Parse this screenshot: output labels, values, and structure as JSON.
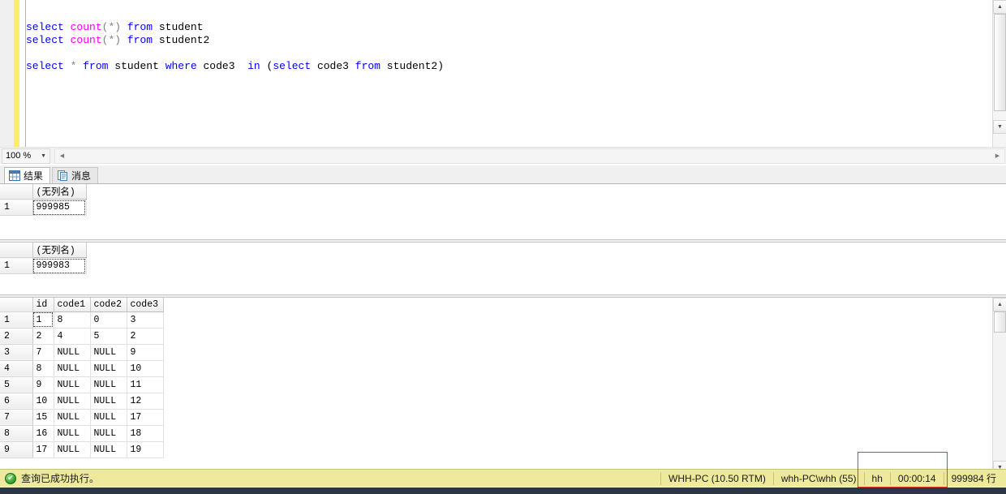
{
  "editor": {
    "zoom_level": "100 %",
    "change_bar_color": "#fbeb6e",
    "lines": [
      [
        {
          "t": "select",
          "c": "kw"
        },
        {
          "t": " ",
          "c": "plain"
        },
        {
          "t": "count",
          "c": "fn"
        },
        {
          "t": "(*)",
          "c": "op"
        },
        {
          "t": " ",
          "c": "plain"
        },
        {
          "t": "from",
          "c": "kw"
        },
        {
          "t": " student",
          "c": "plain"
        }
      ],
      [
        {
          "t": "select",
          "c": "kw"
        },
        {
          "t": " ",
          "c": "plain"
        },
        {
          "t": "count",
          "c": "fn"
        },
        {
          "t": "(*)",
          "c": "op"
        },
        {
          "t": " ",
          "c": "plain"
        },
        {
          "t": "from",
          "c": "kw"
        },
        {
          "t": " student2",
          "c": "plain"
        }
      ],
      [],
      [
        {
          "t": "select",
          "c": "kw"
        },
        {
          "t": " ",
          "c": "plain"
        },
        {
          "t": "*",
          "c": "op"
        },
        {
          "t": " ",
          "c": "plain"
        },
        {
          "t": "from",
          "c": "kw"
        },
        {
          "t": " student ",
          "c": "plain"
        },
        {
          "t": "where",
          "c": "kw"
        },
        {
          "t": " code3  ",
          "c": "plain"
        },
        {
          "t": "in",
          "c": "kw"
        },
        {
          "t": " (",
          "c": "plain"
        },
        {
          "t": "select",
          "c": "kw"
        },
        {
          "t": " code3 ",
          "c": "plain"
        },
        {
          "t": "from",
          "c": "kw"
        },
        {
          "t": " student2)",
          "c": "plain"
        }
      ]
    ],
    "plain_text": "select count(*) from student\nselect count(*) from student2\n\nselect * from student where code3  in (select code3 from student2)"
  },
  "tabs": [
    {
      "label": "结果",
      "icon": "grid-icon",
      "active": true
    },
    {
      "label": "消息",
      "icon": "messages-icon",
      "active": false
    }
  ],
  "results": {
    "grid1": {
      "columns": [
        "",
        "(无列名)"
      ],
      "rows": [
        {
          "row_number": "1",
          "cells": [
            "999985"
          ]
        }
      ]
    },
    "grid2": {
      "columns": [
        "",
        "(无列名)"
      ],
      "rows": [
        {
          "row_number": "1",
          "cells": [
            "999983"
          ]
        }
      ]
    },
    "grid3": {
      "columns": [
        "",
        "id",
        "code1",
        "code2",
        "code3"
      ],
      "rows": [
        {
          "row_number": "1",
          "cells": [
            "1",
            "8",
            "0",
            "3"
          ]
        },
        {
          "row_number": "2",
          "cells": [
            "2",
            "4",
            "5",
            "2"
          ]
        },
        {
          "row_number": "3",
          "cells": [
            "7",
            "NULL",
            "NULL",
            "9"
          ]
        },
        {
          "row_number": "4",
          "cells": [
            "8",
            "NULL",
            "NULL",
            "10"
          ]
        },
        {
          "row_number": "5",
          "cells": [
            "9",
            "NULL",
            "NULL",
            "11"
          ]
        },
        {
          "row_number": "6",
          "cells": [
            "10",
            "NULL",
            "NULL",
            "12"
          ]
        },
        {
          "row_number": "7",
          "cells": [
            "15",
            "NULL",
            "NULL",
            "17"
          ]
        },
        {
          "row_number": "8",
          "cells": [
            "16",
            "NULL",
            "NULL",
            "18"
          ]
        },
        {
          "row_number": "9",
          "cells": [
            "17",
            "NULL",
            "NULL",
            "19"
          ]
        }
      ]
    }
  },
  "status_bar": {
    "message": "查询已成功执行。",
    "server": "WHH-PC (10.50 RTM)",
    "login": "whh-PC\\whh (55)",
    "database": "hh",
    "elapsed": "00:00:14",
    "row_count": "999984 行",
    "background_color": "#eeea9b",
    "highlight_color": "#e03b2f"
  }
}
